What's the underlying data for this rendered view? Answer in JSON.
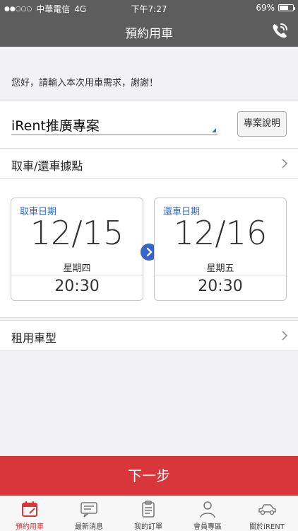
{
  "status_bar": {
    "signal_dots": "●●○○○",
    "carrier": "中華電信",
    "network": "4G",
    "time": "下午7:27",
    "battery_text": "69%",
    "battery_level": 0.69
  },
  "nav": {
    "title": "預約用車",
    "phone_icon": "phone-icon"
  },
  "greeting": "您好，請輸入本次用車需求，謝謝！",
  "project": {
    "selected": "iRent推廣專案",
    "info_button": "專案說明"
  },
  "pickup_location_label": "取車/還車據點",
  "pickup": {
    "caption": "取車日期",
    "date": "12/15",
    "weekday": "星期四",
    "time": "20:30"
  },
  "return": {
    "caption": "還車日期",
    "date": "12/16",
    "weekday": "星期五",
    "time": "20:30"
  },
  "car_type_label": "租用車型",
  "next_button": "下一步",
  "tabs": [
    {
      "label": "預約用車",
      "icon": "calendar-icon",
      "active": true
    },
    {
      "label": "最新消息",
      "icon": "message-icon",
      "active": false
    },
    {
      "label": "我的訂單",
      "icon": "clipboard-icon",
      "active": false
    },
    {
      "label": "會員專區",
      "icon": "person-icon",
      "active": false
    },
    {
      "label": "關於iRENT",
      "icon": "car-icon",
      "active": false
    }
  ],
  "colors": {
    "accent_red": "#d8363b",
    "accent_blue": "#2e6ad0",
    "nav_gray": "#5d5d5d"
  }
}
